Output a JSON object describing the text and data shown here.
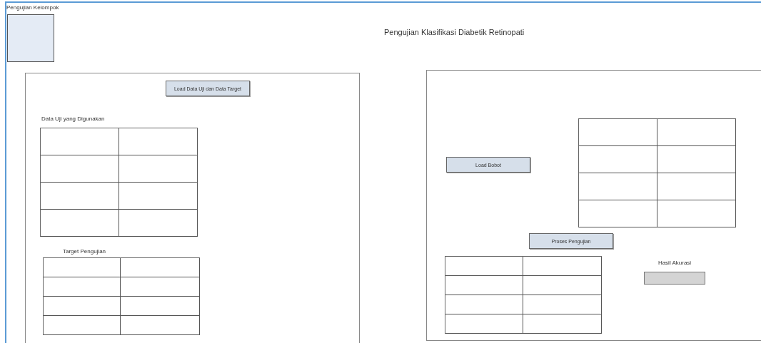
{
  "window": {
    "title": "Pengujian Kelompok",
    "heading": "Pengujian Klasifikasi Diabetik Retinopati"
  },
  "image_box": {
    "kind": "empty"
  },
  "left_panel": {
    "load_button": "Load Data Uji dan Data Target",
    "test_data": {
      "label": "Data Uji yang Digunakan",
      "rows": [
        {
          "cells": [
            {
              "kind": "empty"
            },
            {
              "kind": "empty"
            }
          ]
        },
        {
          "cells": [
            {
              "kind": "empty"
            },
            {
              "kind": "empty"
            }
          ]
        },
        {
          "cells": [
            {
              "kind": "empty"
            },
            {
              "kind": "empty"
            }
          ]
        },
        {
          "cells": [
            {
              "kind": "empty"
            },
            {
              "kind": "empty"
            }
          ]
        }
      ]
    },
    "target": {
      "label": "Target Pengujian",
      "rows": [
        {
          "cells": [
            {
              "kind": "empty"
            },
            {
              "kind": "empty"
            }
          ]
        },
        {
          "cells": [
            {
              "kind": "empty"
            },
            {
              "kind": "empty"
            }
          ]
        },
        {
          "cells": [
            {
              "kind": "empty"
            },
            {
              "kind": "empty"
            }
          ]
        },
        {
          "cells": [
            {
              "kind": "empty"
            },
            {
              "kind": "empty"
            }
          ]
        }
      ]
    }
  },
  "right_panel": {
    "load_button": "Load Bobot",
    "weights": {
      "rows": [
        {
          "cells": [
            {
              "kind": "empty"
            },
            {
              "kind": "empty"
            }
          ]
        },
        {
          "cells": [
            {
              "kind": "empty"
            },
            {
              "kind": "empty"
            }
          ]
        },
        {
          "cells": [
            {
              "kind": "empty"
            },
            {
              "kind": "empty"
            }
          ]
        },
        {
          "cells": [
            {
              "kind": "empty"
            },
            {
              "kind": "empty"
            }
          ]
        }
      ]
    },
    "process_button": "Proses Pengujian",
    "results": {
      "rows": [
        {
          "cells": [
            {
              "kind": "empty"
            },
            {
              "kind": "empty"
            }
          ]
        },
        {
          "cells": [
            {
              "kind": "empty"
            },
            {
              "kind": "empty"
            }
          ]
        },
        {
          "cells": [
            {
              "kind": "empty"
            },
            {
              "kind": "empty"
            }
          ]
        },
        {
          "cells": [
            {
              "kind": "empty"
            },
            {
              "kind": "empty"
            }
          ]
        }
      ]
    },
    "accuracy": {
      "label": "Hasil Akurasi",
      "kind": "empty"
    }
  }
}
